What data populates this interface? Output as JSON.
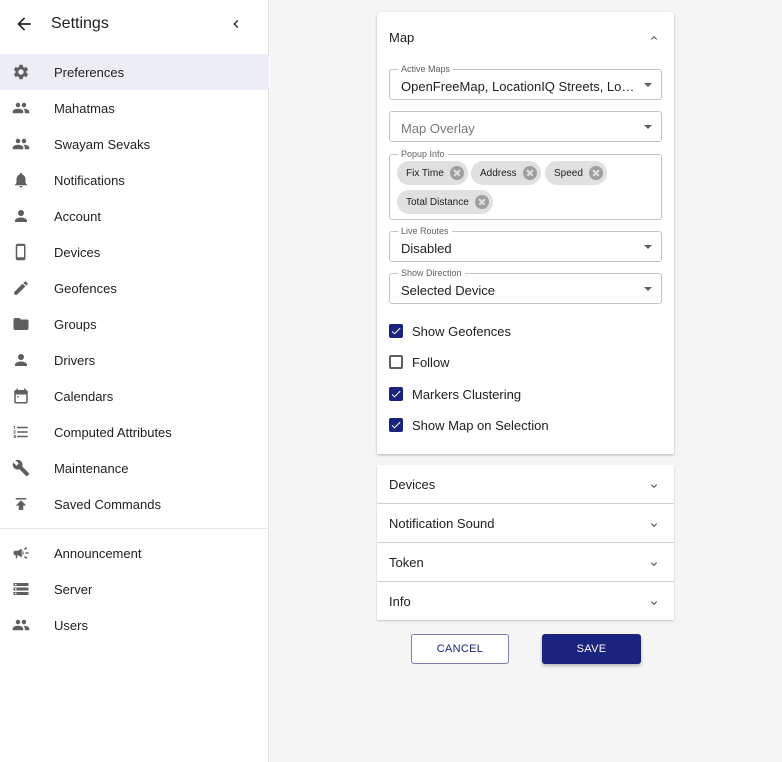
{
  "sidebar": {
    "title": "Settings",
    "items": [
      {
        "label": "Preferences",
        "icon": "gear-icon",
        "selected": true
      },
      {
        "label": "Mahatmas",
        "icon": "people-icon"
      },
      {
        "label": "Swayam Sevaks",
        "icon": "people-icon"
      },
      {
        "label": "Notifications",
        "icon": "bell-icon"
      },
      {
        "label": "Account",
        "icon": "person-icon"
      },
      {
        "label": "Devices",
        "icon": "phone-icon"
      },
      {
        "label": "Geofences",
        "icon": "pencil-icon"
      },
      {
        "label": "Groups",
        "icon": "folder-icon"
      },
      {
        "label": "Drivers",
        "icon": "person-icon"
      },
      {
        "label": "Calendars",
        "icon": "calendar-icon"
      },
      {
        "label": "Computed Attributes",
        "icon": "list-icon"
      },
      {
        "label": "Maintenance",
        "icon": "wrench-icon"
      },
      {
        "label": "Saved Commands",
        "icon": "publish-icon"
      }
    ],
    "admin_items": [
      {
        "label": "Announcement",
        "icon": "megaphone-icon"
      },
      {
        "label": "Server",
        "icon": "storage-icon"
      },
      {
        "label": "Users",
        "icon": "people-icon"
      }
    ]
  },
  "map_section": {
    "title": "Map",
    "active_maps": {
      "label": "Active Maps",
      "value": "OpenFreeMap, LocationIQ Streets, Locati…"
    },
    "map_overlay": {
      "placeholder": "Map Overlay"
    },
    "popup_info": {
      "label": "Popup Info",
      "chips": [
        "Fix Time",
        "Address",
        "Speed",
        "Total Distance"
      ]
    },
    "live_routes": {
      "label": "Live Routes",
      "value": "Disabled"
    },
    "show_direction": {
      "label": "Show Direction",
      "value": "Selected Device"
    },
    "checkboxes": [
      {
        "label": "Show Geofences",
        "checked": true
      },
      {
        "label": "Follow",
        "checked": false
      },
      {
        "label": "Markers Clustering",
        "checked": true
      },
      {
        "label": "Show Map on Selection",
        "checked": true
      }
    ]
  },
  "sections": [
    {
      "title": "Devices"
    },
    {
      "title": "Notification Sound"
    },
    {
      "title": "Token"
    },
    {
      "title": "Info"
    }
  ],
  "buttons": {
    "cancel": "CANCEL",
    "save": "SAVE"
  },
  "colors": {
    "primary": "#1a237e",
    "selected_bg": "#ededf5",
    "main_bg": "#f5f5f5"
  }
}
